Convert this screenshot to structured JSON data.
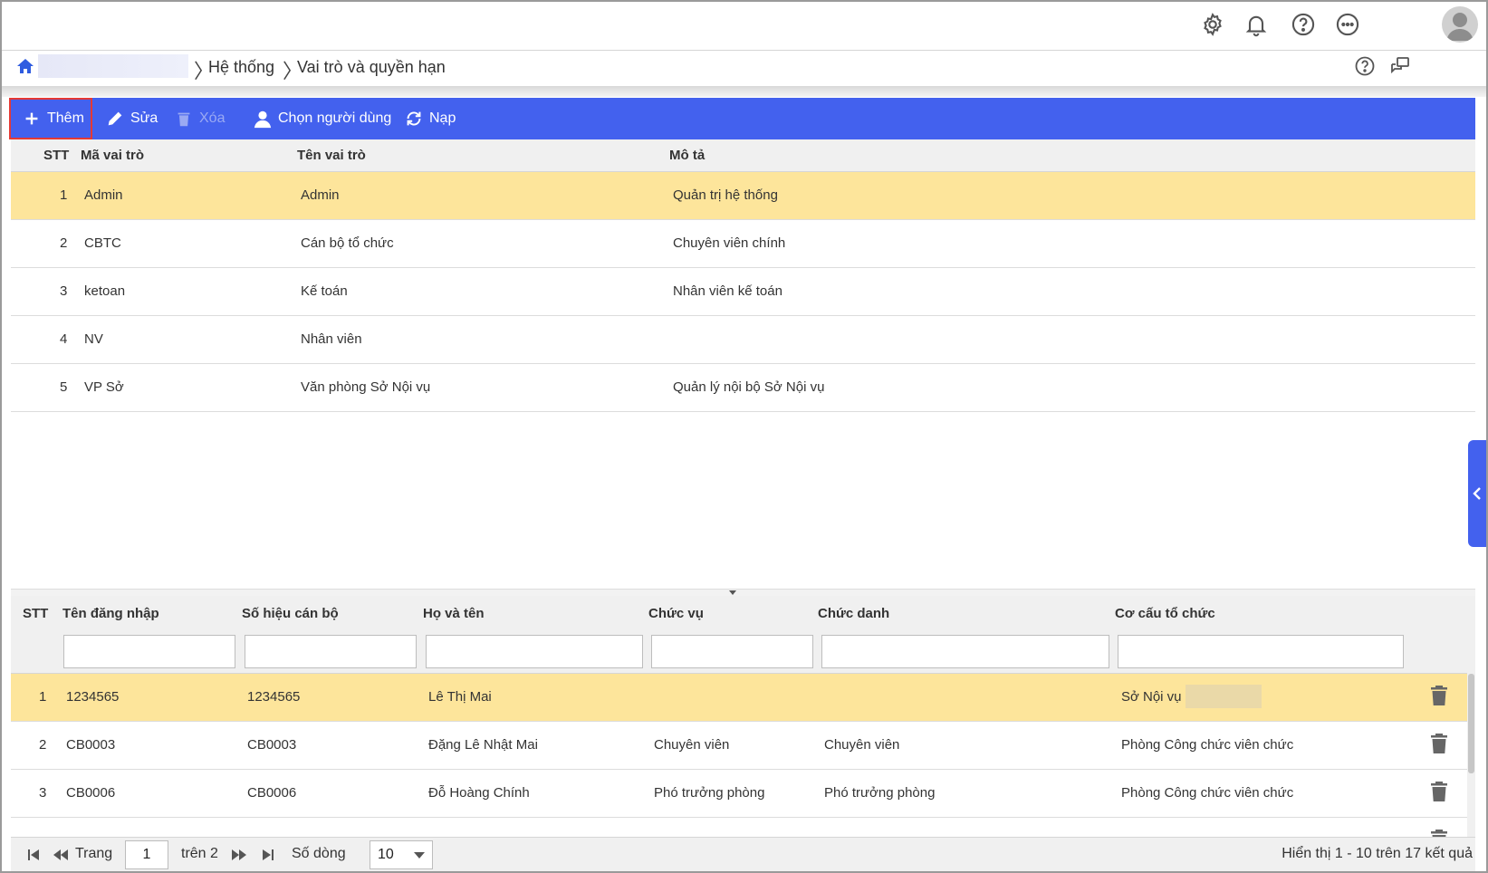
{
  "header": {
    "icons": [
      "gear-icon",
      "bell-icon",
      "help-icon",
      "more-icon",
      "avatar-icon"
    ]
  },
  "breadcrumb": {
    "items": [
      "Hệ thống",
      "Vai trò và quyền hạn"
    ]
  },
  "toolbar": {
    "add_label": "Thêm",
    "edit_label": "Sửa",
    "delete_label": "Xóa",
    "choose_user_label": "Chọn người dùng",
    "reload_label": "Nạp"
  },
  "roles_grid": {
    "columns": [
      "STT",
      "Mã vai trò",
      "Tên vai trò",
      "Mô tả"
    ],
    "rows": [
      {
        "stt": "1",
        "code": "Admin",
        "name": "Admin",
        "desc": "Quản trị hệ thống"
      },
      {
        "stt": "2",
        "code": "CBTC",
        "name": "Cán bộ tổ chức",
        "desc": "Chuyên viên chính"
      },
      {
        "stt": "3",
        "code": "ketoan",
        "name": "Kế toán",
        "desc": "Nhân viên kế toán"
      },
      {
        "stt": "4",
        "code": "NV",
        "name": "Nhân viên",
        "desc": ""
      },
      {
        "stt": "5",
        "code": "VP Sở",
        "name": "Văn phòng Sở Nội vụ",
        "desc": "Quản lý nội bộ Sở Nội vụ"
      }
    ]
  },
  "users_grid": {
    "columns": [
      "STT",
      "Tên đăng nhập",
      "Số hiệu cán bộ",
      "Họ và tên",
      "Chức vụ",
      "Chức danh",
      "Cơ cấu tổ chức"
    ],
    "rows": [
      {
        "stt": "1",
        "username": "1234565",
        "staff_no": "1234565",
        "full_name": "Lê Thị Mai",
        "position": "",
        "title": "",
        "org": "Sở Nội vụ"
      },
      {
        "stt": "2",
        "username": "CB0003",
        "staff_no": "CB0003",
        "full_name": "Đặng Lê Nhật Mai",
        "position": "Chuyên viên",
        "title": "Chuyên viên",
        "org": "Phòng Công chức viên chức"
      },
      {
        "stt": "3",
        "username": "CB0006",
        "staff_no": "CB0006",
        "full_name": "Đỗ Hoàng Chính",
        "position": "Phó trưởng phòng",
        "title": "Phó trưởng phòng",
        "org": "Phòng Công chức viên chức"
      }
    ]
  },
  "pager": {
    "page_label": "Trang",
    "page_value": "1",
    "of_label": "trên 2",
    "rows_label": "Số dòng",
    "rows_value": "10",
    "summary": "Hiển thị 1 - 10 trên 17 kết quả"
  },
  "colors": {
    "toolbar": "#4361ee",
    "selected_row": "#fde59b"
  }
}
